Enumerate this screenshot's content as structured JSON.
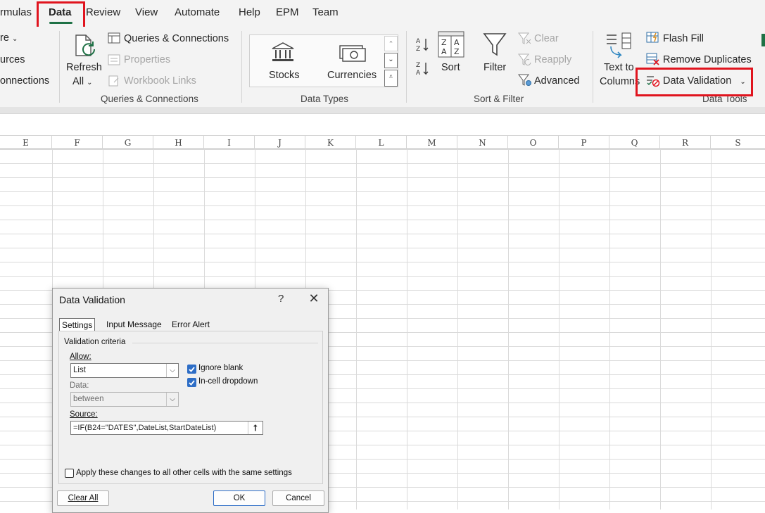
{
  "tabs": [
    "rmulas",
    "Data",
    "Review",
    "View",
    "Automate",
    "Help",
    "EPM",
    "Team"
  ],
  "ribbon": {
    "get_data_partial": [
      "re",
      "urces",
      "onnections"
    ],
    "refresh": [
      "Refresh",
      "All"
    ],
    "queries": {
      "connections": "Queries & Connections",
      "properties": "Properties",
      "workbook_links": "Workbook Links",
      "group": "Queries & Connections"
    },
    "data_types": {
      "stocks": "Stocks",
      "currencies": "Currencies",
      "group": "Data Types"
    },
    "sort_filter": {
      "sort": "Sort",
      "filter": "Filter",
      "clear": "Clear",
      "reapply": "Reapply",
      "advanced": "Advanced",
      "group": "Sort & Filter"
    },
    "data_tools": {
      "text_to_columns": [
        "Text to",
        "Columns"
      ],
      "flash_fill": "Flash Fill",
      "remove_duplicates": "Remove Duplicates",
      "data_validation": "Data Validation",
      "group": "Data Tools"
    }
  },
  "columns": [
    "E",
    "F",
    "G",
    "H",
    "I",
    "J",
    "K",
    "L",
    "M",
    "N",
    "O",
    "P",
    "Q",
    "R",
    "S"
  ],
  "dialog": {
    "title": "Data Validation",
    "help": "?",
    "close": "✕",
    "tabs": [
      "Settings",
      "Input Message",
      "Error Alert"
    ],
    "section": "Validation criteria",
    "allow_label": "Allow:",
    "allow_value": "List",
    "ignore_blank": "Ignore blank",
    "in_cell_dropdown": "In-cell dropdown",
    "data_label": "Data:",
    "data_value": "between",
    "source_label": "Source:",
    "source_value": "=IF(B24=\"DATES\",DateList,StartDateList)",
    "apply_all": "Apply these changes to all other cells with the same settings",
    "clear_all": "Clear All",
    "ok": "OK",
    "cancel": "Cancel"
  },
  "colors": {
    "accent": "#1e7145",
    "highlight": "#e0141e",
    "checkbox": "#2d6dc6"
  }
}
